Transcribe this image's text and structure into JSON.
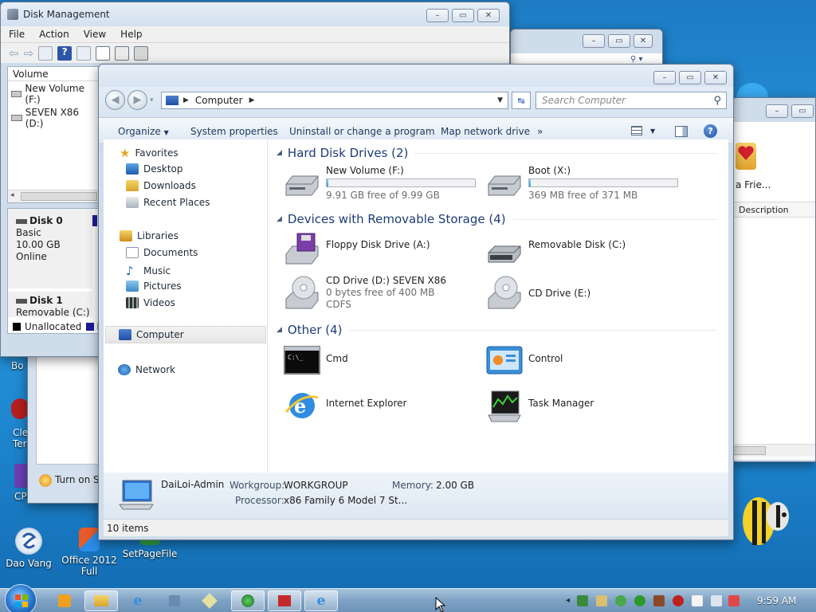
{
  "desktop": {
    "icons": [
      {
        "label": "Dao Vang"
      },
      {
        "label": "Office 2012 Full"
      },
      {
        "label": "SetPageFile"
      }
    ],
    "fragments": [
      "Bo",
      "Cle",
      "Ter",
      "CP"
    ]
  },
  "disk_mgmt": {
    "title": "Disk Management",
    "menu": [
      "File",
      "Action",
      "View",
      "Help"
    ],
    "column_volume": "Volume",
    "volumes": [
      "New Volume (F:)",
      "SEVEN X86 (D:)"
    ],
    "disk0": {
      "name": "Disk 0",
      "type": "Basic",
      "size": "10.00 GB",
      "status": "Online"
    },
    "disk1": {
      "name": "Disk 1",
      "type": "Removable (C:)"
    },
    "legend_unallocated": "Unallocated",
    "legend_p": "P"
  },
  "back_window": {
    "fragment_name": "a Frie...",
    "col_description": "Description"
  },
  "small_window": {
    "turn_on": "Turn on Sc"
  },
  "explorer": {
    "breadcrumb": "Computer",
    "search_placeholder": "Search Computer",
    "commands": [
      "Organize",
      "System properties",
      "Uninstall or change a program",
      "Map network drive",
      "»"
    ],
    "nav": {
      "favorites": "Favorites",
      "desktop": "Desktop",
      "downloads": "Downloads",
      "recent": "Recent Places",
      "libraries": "Libraries",
      "documents": "Documents",
      "music": "Music",
      "pictures": "Pictures",
      "videos": "Videos",
      "computer": "Computer",
      "network": "Network"
    },
    "groups": {
      "hdd": "Hard Disk Drives (2)",
      "removable": "Devices with Removable Storage (4)",
      "other": "Other (4)"
    },
    "drives": {
      "newvol": {
        "name": "New Volume (F:)",
        "free": "9.91 GB free of 9.99 GB",
        "used_fraction": 0.008
      },
      "boot": {
        "name": "Boot (X:)",
        "free": "369 MB free of 371 MB",
        "used_fraction": 0.005
      },
      "floppy": {
        "name": "Floppy Disk Drive (A:)"
      },
      "removable": {
        "name": "Removable Disk (C:)"
      },
      "cdd": {
        "name": "CD Drive (D:) SEVEN X86",
        "free": "0 bytes free of 400 MB",
        "fs": "CDFS"
      },
      "cde": {
        "name": "CD Drive (E:)"
      },
      "cmd": {
        "name": "Cmd"
      },
      "control": {
        "name": "Control"
      },
      "ie": {
        "name": "Internet Explorer"
      },
      "taskmgr": {
        "name": "Task Manager"
      }
    },
    "details": {
      "computer_name": "DaiLoi-Admin",
      "workgroup_label": "Workgroup:",
      "workgroup": "WORKGROUP",
      "memory_label": "Memory:",
      "memory": "2.00 GB",
      "processor_label": "Processor:",
      "processor": "x86 Family 6 Model 7 St..."
    },
    "status": "10 items"
  },
  "taskbar": {
    "clock": "9:59 AM"
  },
  "colors": {
    "accent": "#1e3c78",
    "title_bg": "#d3e0ee",
    "desktop": "#2a9ae0"
  }
}
